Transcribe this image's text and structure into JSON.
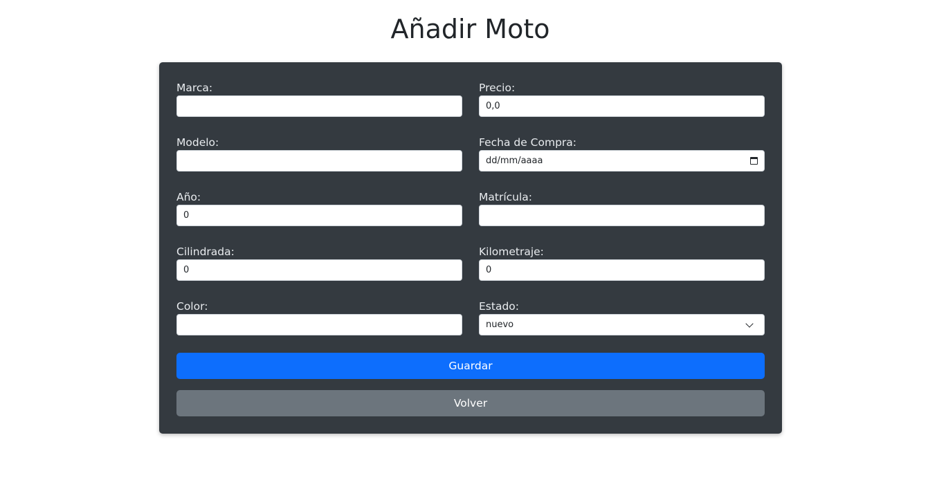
{
  "page": {
    "title": "Añadir Moto"
  },
  "form": {
    "marca": {
      "label": "Marca:",
      "value": ""
    },
    "precio": {
      "label": "Precio:",
      "value": "0,0"
    },
    "modelo": {
      "label": "Modelo:",
      "value": ""
    },
    "fecha_compra": {
      "label": "Fecha de Compra:",
      "value": "dd/mm/aaaa"
    },
    "anio": {
      "label": "Año:",
      "value": "0"
    },
    "matricula": {
      "label": "Matrícula:",
      "value": ""
    },
    "cilindrada": {
      "label": "Cilindrada:",
      "value": "0"
    },
    "kilometraje": {
      "label": "Kilometraje:",
      "value": "0"
    },
    "color": {
      "label": "Color:",
      "value": ""
    },
    "estado": {
      "label": "Estado:",
      "value": "nuevo"
    }
  },
  "buttons": {
    "guardar": "Guardar",
    "volver": "Volver"
  },
  "colors": {
    "card_background": "#343a40",
    "primary": "#0d6efd",
    "secondary": "#6c757d"
  },
  "icons": {
    "date": "calendar-icon",
    "select": "chevron-down-icon"
  }
}
